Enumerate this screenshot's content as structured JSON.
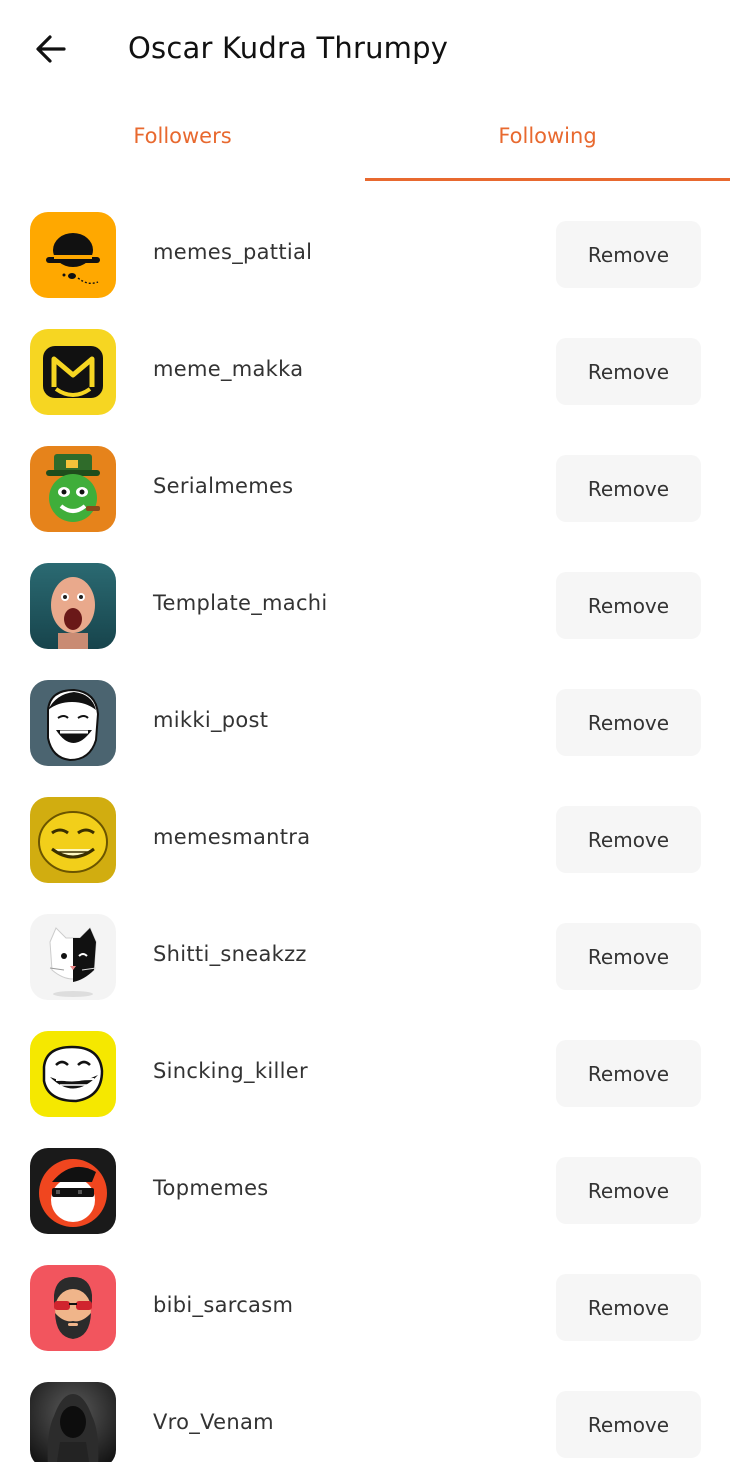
{
  "header": {
    "title": "Oscar Kudra Thrumpy",
    "back_icon": "arrow-left-icon"
  },
  "tabs": [
    {
      "label": "Followers",
      "active": false
    },
    {
      "label": "Following",
      "active": true
    }
  ],
  "accent_color": "#e8692f",
  "remove_label": "Remove",
  "users": [
    {
      "username": "memes_pattial",
      "avatar_icon": "bowler-hat-avatar",
      "avatar_color": "#ffa800"
    },
    {
      "username": "meme_makka",
      "avatar_icon": "letter-m-avatar",
      "avatar_color": "#f6d622"
    },
    {
      "username": "Serialmemes",
      "avatar_icon": "green-leprechaun-avatar",
      "avatar_color": "#e6831b"
    },
    {
      "username": "Template_machi",
      "avatar_icon": "screaming-man-avatar",
      "avatar_color": "#2b6a72"
    },
    {
      "username": "mikki_post",
      "avatar_icon": "laughing-meme-face-avatar",
      "avatar_color": "#4b6470"
    },
    {
      "username": "memesmantra",
      "avatar_icon": "yellow-smirk-face-avatar",
      "avatar_color": "#d1ad10"
    },
    {
      "username": "Shitti_sneakzz",
      "avatar_icon": "cat-face-avatar",
      "avatar_color": "#f4f4f4"
    },
    {
      "username": "Sincking_killer",
      "avatar_icon": "troll-face-avatar",
      "avatar_color": "#f5e800"
    },
    {
      "username": "Topmemes",
      "avatar_icon": "top-gun-cap-avatar",
      "avatar_color": "#1a1a1a"
    },
    {
      "username": "bibi_sarcasm",
      "avatar_icon": "bearded-man-sunglasses-avatar",
      "avatar_color": "#f2555e"
    },
    {
      "username": "Vro_Venam",
      "avatar_icon": "hooded-figure-avatar",
      "avatar_color": "#2a2a2a"
    }
  ]
}
